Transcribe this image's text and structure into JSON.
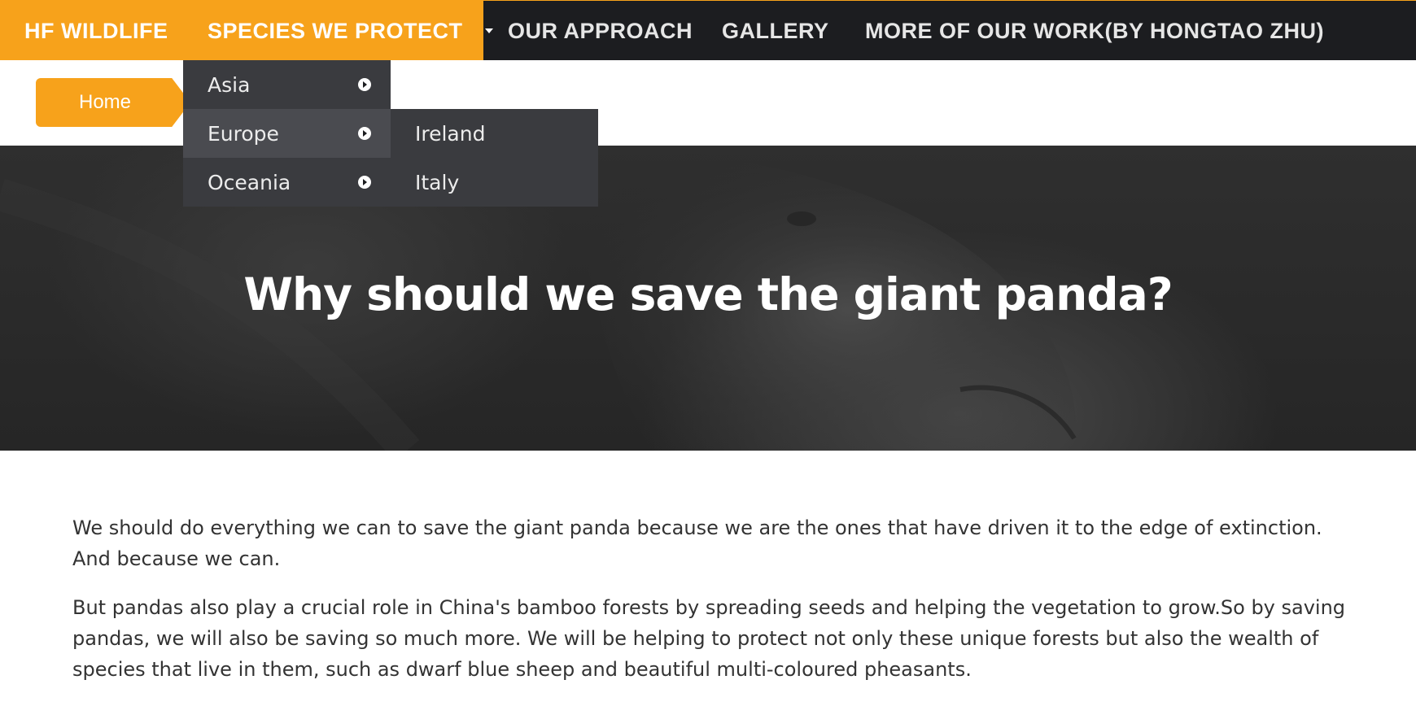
{
  "nav": {
    "brand": "HF WILDLIFE",
    "species": "SPECIES WE PROTECT",
    "approach": "OUR APPROACH",
    "gallery": "GALLERY",
    "more": "MORE OF OUR WORK(BY HONGTAO ZHU)",
    "active_color": "#f7a21b",
    "bar_color": "#1c1d20"
  },
  "dropdown": {
    "items": [
      {
        "label": "Asia",
        "icon": "chevron-right-circle-icon"
      },
      {
        "label": "Europe",
        "icon": "chevron-right-circle-icon",
        "hovered": true
      },
      {
        "label": "Oceania",
        "icon": "chevron-right-circle-icon"
      }
    ],
    "submenu": [
      "Ireland",
      "Italy"
    ]
  },
  "breadcrumb": {
    "home": "Home"
  },
  "hero": {
    "title": "Why should we save the giant panda?"
  },
  "content": {
    "paragraphs": [
      "We should do everything we can to save the giant panda because we are the ones that have driven it to the edge of extinction. And because we can.",
      "But pandas also play a crucial role in China's bamboo forests by spreading seeds and helping the vegetation to grow.So by saving pandas, we will also be saving so much more. We will be helping to protect not only these unique forests but also the wealth of species that live in them, such as dwarf blue sheep and beautiful multi-coloured pheasants."
    ]
  }
}
